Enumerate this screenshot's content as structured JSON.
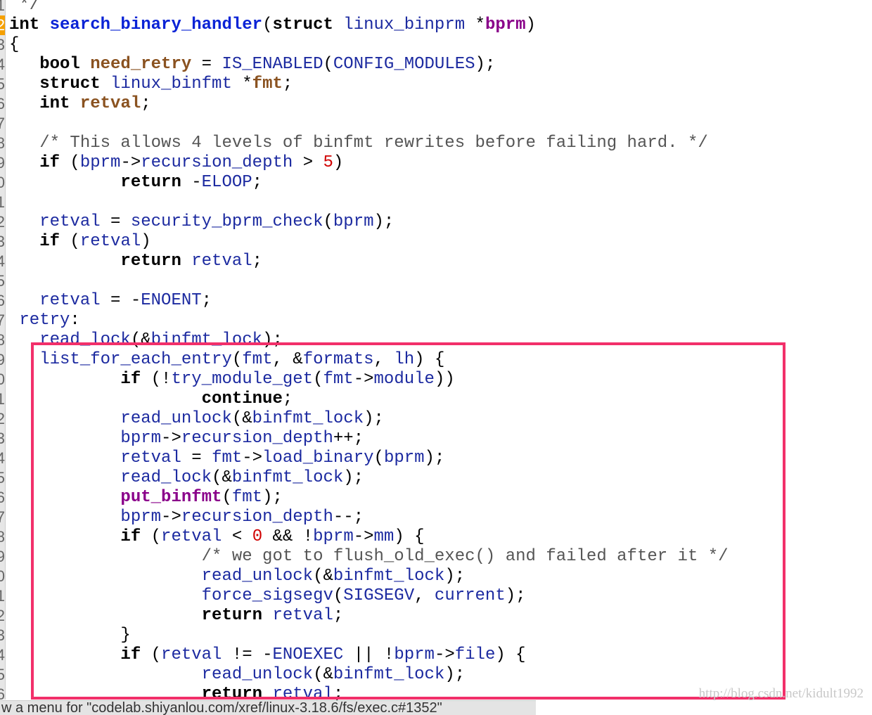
{
  "gutter": {
    "line_digits": [
      "1",
      "2",
      "3",
      "4",
      "5",
      "6",
      "7",
      "8",
      "9",
      "0",
      "1",
      "2",
      "3",
      "4",
      "5",
      "6",
      "7",
      "8",
      "9",
      "0",
      "1",
      "2",
      "3",
      "4",
      "5",
      "6",
      "7",
      "8",
      "9",
      "0",
      "1",
      "2",
      "3",
      "4",
      "5",
      "6"
    ],
    "current_index": 1
  },
  "colors": {
    "highlight_box": "#f2306a",
    "current_line": "#f5a000",
    "function": "#0a23d6",
    "identifier": "#1c2aa0",
    "local_var": "#8a5220",
    "number": "#d00000",
    "macro_call": "#8a008a"
  },
  "code": {
    "lines": [
      [
        [
          " */",
          "c"
        ]
      ],
      [
        [
          "int ",
          "k"
        ],
        [
          "search_binary_handler",
          "f"
        ],
        [
          "(",
          "p"
        ],
        [
          "struct ",
          "k"
        ],
        [
          "linux_binprm ",
          "i"
        ],
        [
          "*",
          "p"
        ],
        [
          "bprm",
          "m"
        ],
        [
          ")",
          "p"
        ]
      ],
      [
        [
          "{",
          "p"
        ]
      ],
      [
        [
          "   bool ",
          "k"
        ],
        [
          "need_retry",
          "v"
        ],
        [
          " = ",
          "p"
        ],
        [
          "IS_ENABLED",
          "i"
        ],
        [
          "(",
          "p"
        ],
        [
          "CONFIG_MODULES",
          "i"
        ],
        [
          ");",
          "p"
        ]
      ],
      [
        [
          "   struct ",
          "k"
        ],
        [
          "linux_binfmt ",
          "i"
        ],
        [
          "*",
          "p"
        ],
        [
          "fmt",
          "v"
        ],
        [
          ";",
          "p"
        ]
      ],
      [
        [
          "   int ",
          "k"
        ],
        [
          "retval",
          "v"
        ],
        [
          ";",
          "p"
        ]
      ],
      [
        [
          "",
          ""
        ]
      ],
      [
        [
          "   /* This allows 4 levels of binfmt rewrites before failing hard. */",
          "c"
        ]
      ],
      [
        [
          "   if ",
          "k"
        ],
        [
          "(",
          "p"
        ],
        [
          "bprm",
          "i"
        ],
        [
          "->",
          "p"
        ],
        [
          "recursion_depth",
          "i"
        ],
        [
          " > ",
          "p"
        ],
        [
          "5",
          "n"
        ],
        [
          ")",
          "p"
        ]
      ],
      [
        [
          "           return ",
          "k"
        ],
        [
          "-",
          "p"
        ],
        [
          "ELOOP",
          "i"
        ],
        [
          ";",
          "p"
        ]
      ],
      [
        [
          "",
          ""
        ]
      ],
      [
        [
          "   retval",
          "i"
        ],
        [
          " = ",
          "p"
        ],
        [
          "security_bprm_check",
          "i"
        ],
        [
          "(",
          "p"
        ],
        [
          "bprm",
          "i"
        ],
        [
          ");",
          "p"
        ]
      ],
      [
        [
          "   if ",
          "k"
        ],
        [
          "(",
          "p"
        ],
        [
          "retval",
          "i"
        ],
        [
          ")",
          "p"
        ]
      ],
      [
        [
          "           return ",
          "k"
        ],
        [
          "retval",
          "i"
        ],
        [
          ";",
          "p"
        ]
      ],
      [
        [
          "",
          ""
        ]
      ],
      [
        [
          "   retval",
          "i"
        ],
        [
          " = -",
          "p"
        ],
        [
          "ENOENT",
          "i"
        ],
        [
          ";",
          "p"
        ]
      ],
      [
        [
          " retry",
          "i"
        ],
        [
          ":",
          "p"
        ]
      ],
      [
        [
          "   read_lock",
          "i"
        ],
        [
          "(&",
          "p"
        ],
        [
          "binfmt_lock",
          "i"
        ],
        [
          ");",
          "p"
        ]
      ],
      [
        [
          "   list_for_each_entry",
          "i"
        ],
        [
          "(",
          "p"
        ],
        [
          "fmt",
          "i"
        ],
        [
          ", &",
          "p"
        ],
        [
          "formats",
          "i"
        ],
        [
          ", ",
          "p"
        ],
        [
          "lh",
          "i"
        ],
        [
          ") {",
          "p"
        ]
      ],
      [
        [
          "           if ",
          "k"
        ],
        [
          "(!",
          "p"
        ],
        [
          "try_module_get",
          "i"
        ],
        [
          "(",
          "p"
        ],
        [
          "fmt",
          "i"
        ],
        [
          "->",
          "p"
        ],
        [
          "module",
          "i"
        ],
        [
          "))",
          "p"
        ]
      ],
      [
        [
          "                   continue",
          "k"
        ],
        [
          ";",
          "p"
        ]
      ],
      [
        [
          "           read_unlock",
          "i"
        ],
        [
          "(&",
          "p"
        ],
        [
          "binfmt_lock",
          "i"
        ],
        [
          ");",
          "p"
        ]
      ],
      [
        [
          "           bprm",
          "i"
        ],
        [
          "->",
          "p"
        ],
        [
          "recursion_depth",
          "i"
        ],
        [
          "++;",
          "p"
        ]
      ],
      [
        [
          "           retval",
          "i"
        ],
        [
          " = ",
          "p"
        ],
        [
          "fmt",
          "i"
        ],
        [
          "->",
          "p"
        ],
        [
          "load_binary",
          "i"
        ],
        [
          "(",
          "p"
        ],
        [
          "bprm",
          "i"
        ],
        [
          ");",
          "p"
        ]
      ],
      [
        [
          "           read_lock",
          "i"
        ],
        [
          "(&",
          "p"
        ],
        [
          "binfmt_lock",
          "i"
        ],
        [
          ");",
          "p"
        ]
      ],
      [
        [
          "           put_binfmt",
          "m"
        ],
        [
          "(",
          "p"
        ],
        [
          "fmt",
          "i"
        ],
        [
          ");",
          "p"
        ]
      ],
      [
        [
          "           bprm",
          "i"
        ],
        [
          "->",
          "p"
        ],
        [
          "recursion_depth",
          "i"
        ],
        [
          "--;",
          "p"
        ]
      ],
      [
        [
          "           if ",
          "k"
        ],
        [
          "(",
          "p"
        ],
        [
          "retval",
          "i"
        ],
        [
          " < ",
          "p"
        ],
        [
          "0",
          "n"
        ],
        [
          " && !",
          "p"
        ],
        [
          "bprm",
          "i"
        ],
        [
          "->",
          "p"
        ],
        [
          "mm",
          "i"
        ],
        [
          ") {",
          "p"
        ]
      ],
      [
        [
          "                   /* we got to flush_old_exec() and failed after it */",
          "c"
        ]
      ],
      [
        [
          "                   read_unlock",
          "i"
        ],
        [
          "(&",
          "p"
        ],
        [
          "binfmt_lock",
          "i"
        ],
        [
          ");",
          "p"
        ]
      ],
      [
        [
          "                   force_sigsegv",
          "i"
        ],
        [
          "(",
          "p"
        ],
        [
          "SIGSEGV",
          "i"
        ],
        [
          ", ",
          "p"
        ],
        [
          "current",
          "i"
        ],
        [
          ");",
          "p"
        ]
      ],
      [
        [
          "                   return ",
          "k"
        ],
        [
          "retval",
          "i"
        ],
        [
          ";",
          "p"
        ]
      ],
      [
        [
          "           }",
          "p"
        ]
      ],
      [
        [
          "           if ",
          "k"
        ],
        [
          "(",
          "p"
        ],
        [
          "retval",
          "i"
        ],
        [
          " != -",
          "p"
        ],
        [
          "ENOEXEC",
          "i"
        ],
        [
          " || !",
          "p"
        ],
        [
          "bprm",
          "i"
        ],
        [
          "->",
          "p"
        ],
        [
          "file",
          "i"
        ],
        [
          ") {",
          "p"
        ]
      ],
      [
        [
          "                   read_unlock",
          "i"
        ],
        [
          "(&",
          "p"
        ],
        [
          "binfmt_lock",
          "i"
        ],
        [
          ");",
          "p"
        ]
      ],
      [
        [
          "                   return ",
          "k"
        ],
        [
          "retval",
          "i"
        ],
        [
          ";",
          "p"
        ]
      ]
    ]
  },
  "watermark": "http://blog.csdn.net/kidult1992",
  "status_bar": "w a menu for \"codelab.shiyanlou.com/xref/linux-3.18.6/fs/exec.c#1352\""
}
